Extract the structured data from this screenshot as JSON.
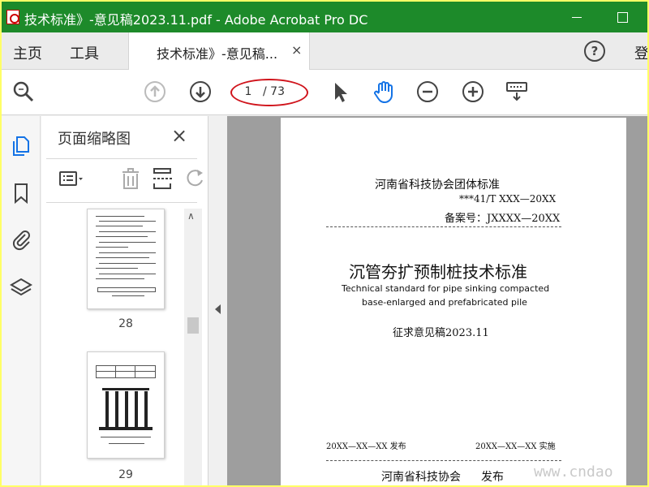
{
  "window": {
    "title": "技术标准》-意见稿2023.11.pdf - Adobe Acrobat Pro DC"
  },
  "menu_tabs": {
    "home": "主页",
    "tools": "工具"
  },
  "doc_tab": {
    "label": "技术标准》-意见稿...",
    "close": "×"
  },
  "header_right": {
    "help": "?",
    "login": "登"
  },
  "toolbar": {
    "page_current": "1",
    "page_total": "/ 73"
  },
  "thumb_panel": {
    "title": "页面缩略图",
    "close": "×",
    "pages": [
      {
        "number": "28"
      },
      {
        "number": "29"
      }
    ]
  },
  "page_content": {
    "org_standard": "河南省科技协会团体标准",
    "code": "***41/T XXX—20XX",
    "record_no": "备案号：JXXXX—20XX",
    "title_cn": "沉管夯扩预制桩技术标准",
    "title_en_line1": "Technical standard for pipe sinking compacted",
    "title_en_line2": "base-enlarged and prefabricated pile",
    "draft": "征求意见稿2023.11",
    "release_date": "20XX—XX—XX 发布",
    "impl_date": "20XX—XX—XX 实施",
    "publisher": "河南省科技协会",
    "publish_label": "发布"
  },
  "watermark": "www.cndao",
  "icons": {
    "zoom": "magnifier-icon",
    "prev_page": "arrow-up-circle-icon",
    "next_page": "arrow-down-circle-icon",
    "select": "pointer-arrow-icon",
    "hand": "hand-icon",
    "zoom_out": "minus-circle-icon",
    "zoom_in": "plus-circle-icon",
    "keyboard": "keyboard-icon"
  },
  "colors": {
    "titlebar": "#1d8a2a",
    "highlight_oval": "#d0141c",
    "active_icon": "#1473e6",
    "frame_border": "#ffff66"
  }
}
